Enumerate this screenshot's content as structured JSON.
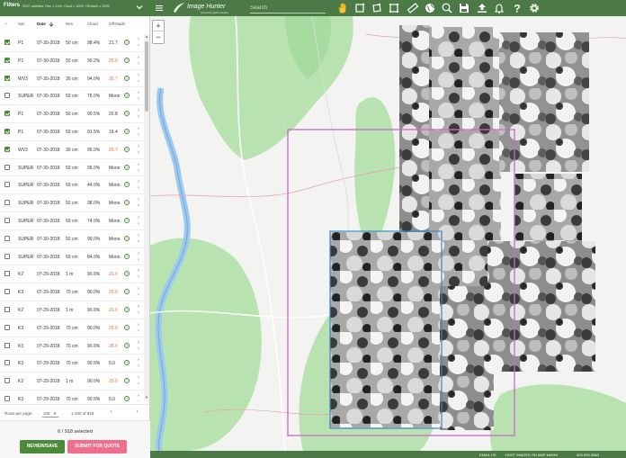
{
  "filters": {
    "title": "Filters",
    "summary": "20/27 satellites, Res. ≤ 2.0m, Cloud ≤ 100%, Off-Nadir ≤ 100%"
  },
  "columns": {
    "check": "✓",
    "sat": "Sat",
    "date": "Date",
    "res": "Res",
    "cloud": "Cloud",
    "off": "Off-Nadir"
  },
  "rows": [
    {
      "checked": true,
      "sat": "P1",
      "date": "07-30-2018",
      "res": "50 cm",
      "cloud": "98.4%",
      "off": "21.7",
      "warn": false
    },
    {
      "checked": true,
      "sat": "P1",
      "date": "07-30-2018",
      "res": "50 cm",
      "cloud": "99.2%",
      "off": "25.0",
      "warn": true
    },
    {
      "checked": true,
      "sat": "WV3",
      "date": "07-30-2018",
      "res": "30 cm",
      "cloud": "94.0%",
      "off": "26.7",
      "warn": true
    },
    {
      "checked": false,
      "sat": "SUPER",
      "date": "07-30-2018",
      "res": "50 cm",
      "cloud": "76.0%",
      "off": "Mono",
      "warn": false
    },
    {
      "checked": true,
      "sat": "P1",
      "date": "07-30-2018",
      "res": "50 cm",
      "cloud": "90.5%",
      "off": "20.8",
      "warn": false
    },
    {
      "checked": true,
      "sat": "P1",
      "date": "07-30-2018",
      "res": "50 cm",
      "cloud": "91.5%",
      "off": "19.4",
      "warn": false
    },
    {
      "checked": true,
      "sat": "WV3",
      "date": "07-30-2018",
      "res": "30 cm",
      "cloud": "99.0%",
      "off": "25.7",
      "warn": true
    },
    {
      "checked": false,
      "sat": "SUPER",
      "date": "07-30-2018",
      "res": "50 cm",
      "cloud": "99.0%",
      "off": "Mono",
      "warn": false
    },
    {
      "checked": false,
      "sat": "SUPER",
      "date": "07-30-2018",
      "res": "50 cm",
      "cloud": "44.0%",
      "off": "Mono",
      "warn": false
    },
    {
      "checked": false,
      "sat": "SUPER",
      "date": "07-30-2018",
      "res": "50 cm",
      "cloud": "98.0%",
      "off": "Mono",
      "warn": false
    },
    {
      "checked": false,
      "sat": "SUPER",
      "date": "07-30-2018",
      "res": "50 cm",
      "cloud": "74.0%",
      "off": "Mono",
      "warn": false
    },
    {
      "checked": false,
      "sat": "SUPER",
      "date": "07-30-2018",
      "res": "50 cm",
      "cloud": "99.0%",
      "off": "Mono",
      "warn": false
    },
    {
      "checked": false,
      "sat": "SUPER",
      "date": "07-30-2018",
      "res": "50 cm",
      "cloud": "84.0%",
      "off": "Mono",
      "warn": false
    },
    {
      "checked": false,
      "sat": "K2",
      "date": "07-29-2018",
      "res": "1 m",
      "cloud": "90.0%",
      "off": "29.0",
      "warn": true
    },
    {
      "checked": false,
      "sat": "K3",
      "date": "07-29-2018",
      "res": "70 cm",
      "cloud": "90.0%",
      "off": "29.0",
      "warn": true
    },
    {
      "checked": false,
      "sat": "K2",
      "date": "07-29-2018",
      "res": "1 m",
      "cloud": "90.0%",
      "off": "29.0",
      "warn": true
    },
    {
      "checked": false,
      "sat": "K3",
      "date": "07-29-2018",
      "res": "70 cm",
      "cloud": "90.0%",
      "off": "29.0",
      "warn": true
    },
    {
      "checked": false,
      "sat": "K3",
      "date": "07-29-2018",
      "res": "70 cm",
      "cloud": "90.0%",
      "off": "28.0",
      "warn": true
    },
    {
      "checked": false,
      "sat": "K3",
      "date": "07-29-2018",
      "res": "70 cm",
      "cloud": "90.0%",
      "off": "5.0",
      "warn": false
    },
    {
      "checked": false,
      "sat": "K2",
      "date": "07-29-2018",
      "res": "1 m",
      "cloud": "90.0%",
      "off": "29.0",
      "warn": true
    },
    {
      "checked": false,
      "sat": "K3",
      "date": "07-29-2018",
      "res": "70 cm",
      "cloud": "90.0%",
      "off": "5.0",
      "warn": false
    }
  ],
  "row_info_glyph": "i",
  "row_up_glyph": "˄",
  "row_down_glyph": "˅",
  "pager": {
    "rows_per_page_label": "Rows per page:",
    "rows_per_page_value": "100",
    "range": "1-100 of 918",
    "prev": "‹",
    "next": "›"
  },
  "selection": {
    "count_text": "6 / 918 selected"
  },
  "buttons": {
    "review": "REVIEW/SAVE",
    "quote": "SUBMIT FOR QUOTE"
  },
  "app": {
    "logo_text": "Image Hunter",
    "logo_sub": "powered by apollo mapping",
    "search_placeholder": "Search"
  },
  "toolbar": {
    "tools": [
      "hand-pan",
      "square-draw",
      "rotate-polygon",
      "crop-box",
      "ruler",
      "globe",
      "zoom-search",
      "save",
      "upload",
      "bell",
      "help",
      "settings"
    ]
  },
  "map": {
    "zoom_in": "+",
    "zoom_out": "−"
  },
  "footer": {
    "email": "EMAIL US",
    "host": "HOST IMAGES ON MAP MAVIN",
    "phone": "303-993-3863"
  },
  "colors": {
    "brand_green": "#4c7a46",
    "check_green": "#4c8a3a",
    "warn_orange": "#e8742a",
    "quote_pink": "#ef6f8c",
    "footprint_magenta": "#c86ac8",
    "footprint_blue": "#3a86c4"
  }
}
